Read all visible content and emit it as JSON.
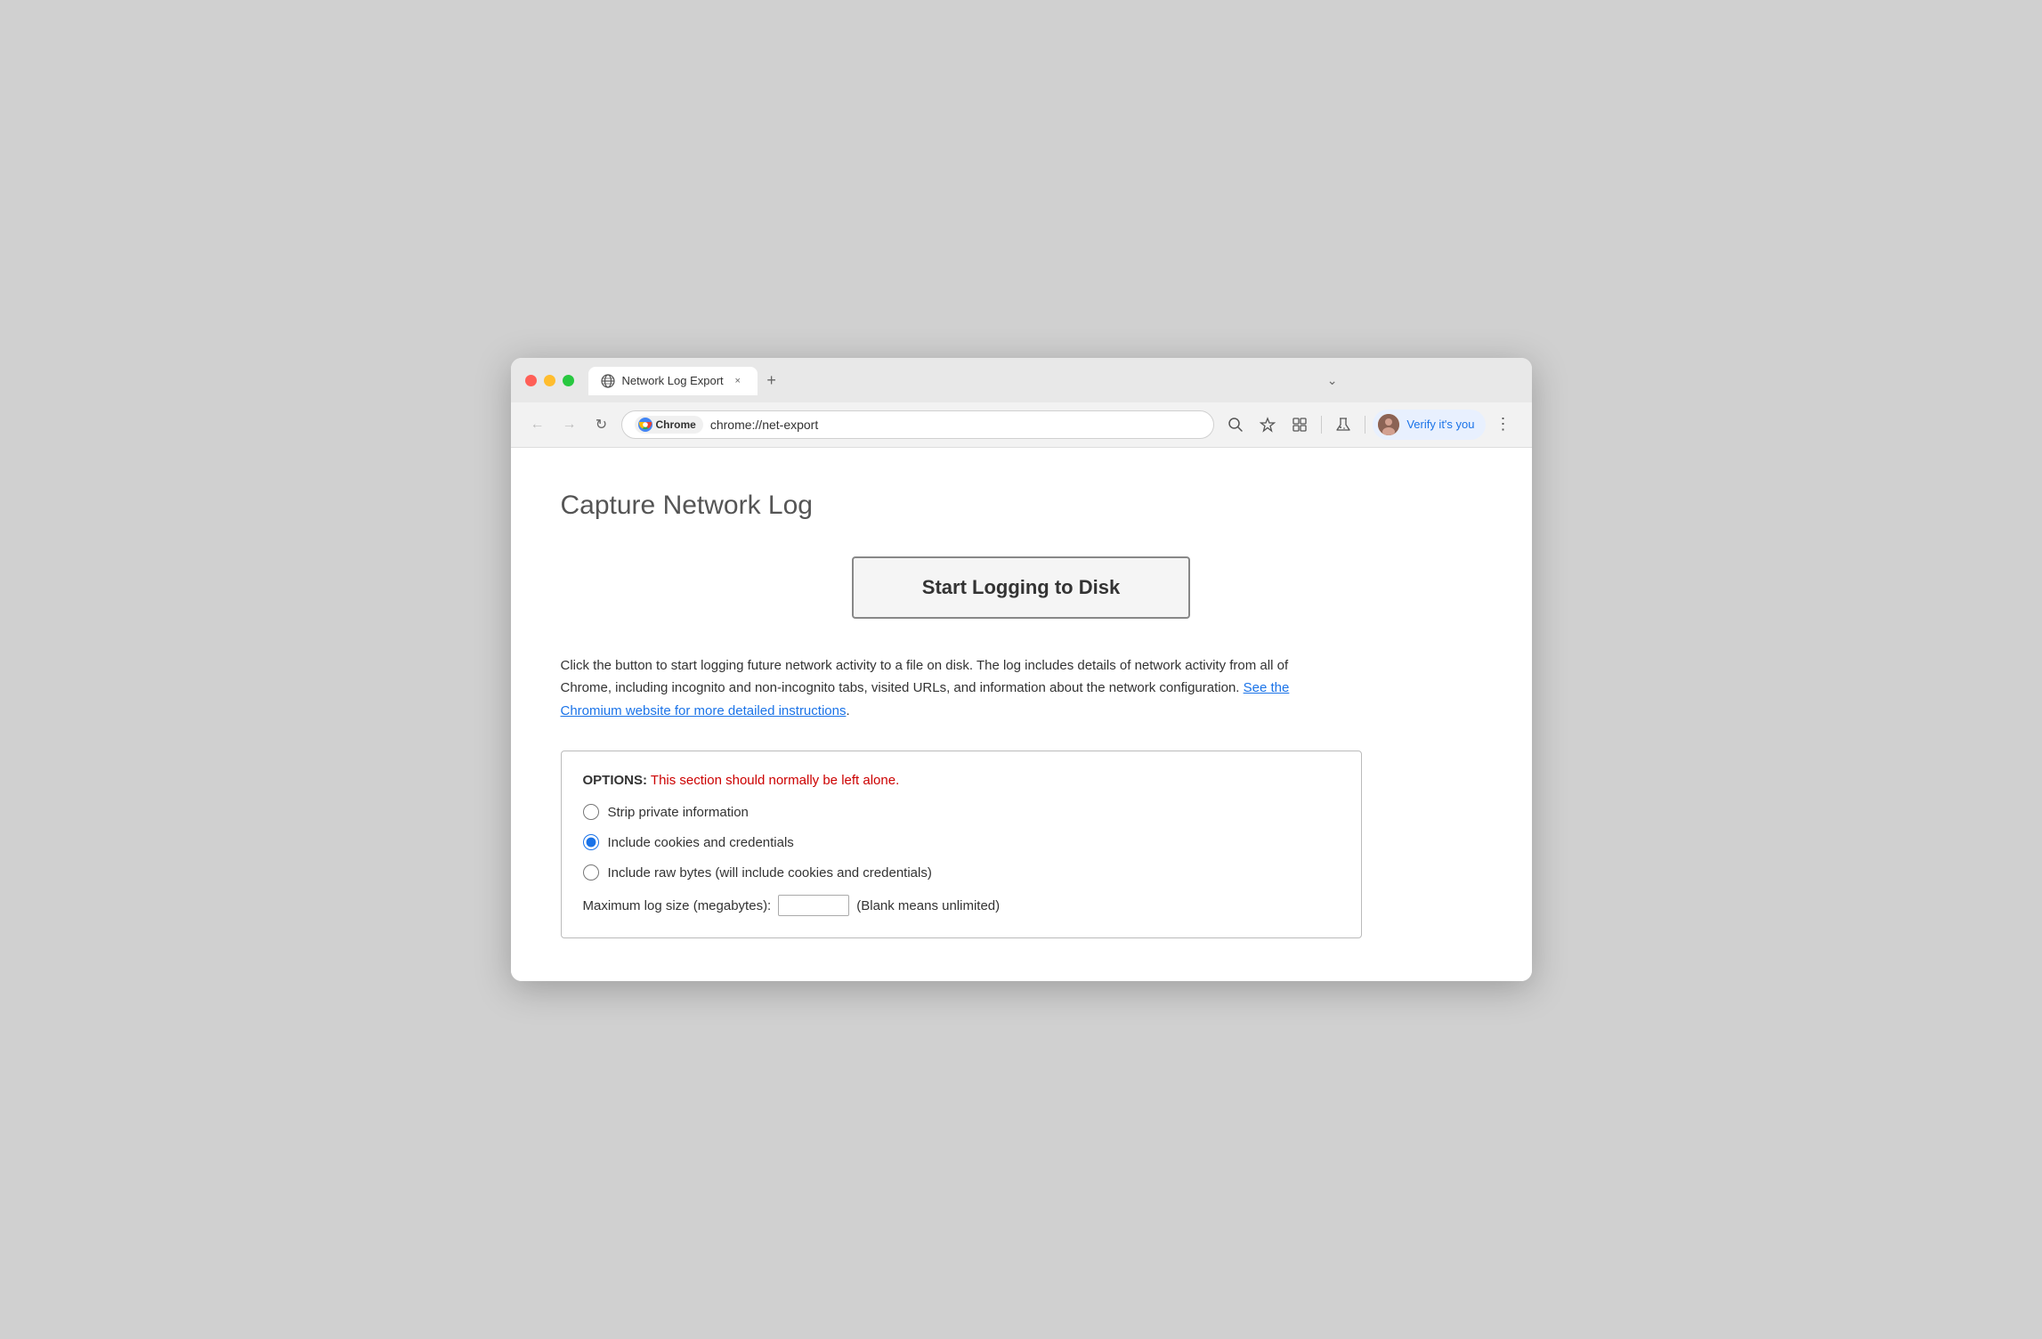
{
  "browser": {
    "tab_title": "Network Log Export",
    "tab_new_label": "+",
    "tab_expand_label": "⌄",
    "tab_close_label": "×"
  },
  "toolbar": {
    "back_label": "←",
    "forward_label": "→",
    "reload_label": "↻",
    "chrome_badge": "Chrome",
    "url": "chrome://net-export",
    "search_icon": "🔍",
    "star_icon": "☆",
    "extensions_icon": "🧩",
    "flask_icon": "⚗",
    "verify_label": "Verify it's you",
    "menu_label": "⋮"
  },
  "page": {
    "title": "Capture Network Log",
    "start_button": "Start Logging to Disk",
    "description_part1": "Click the button to start logging future network activity to a file on disk. The log includes details of network activity from all of Chrome, including incognito and non-incognito tabs, visited URLs, and information about the network configuration. ",
    "link_text": "See the Chromium website for more detailed instructions",
    "description_part2": ".",
    "options_label": "OPTIONS:",
    "options_warning": " This section should normally be left alone.",
    "option1": "Strip private information",
    "option2": "Include cookies and credentials",
    "option3": "Include raw bytes (will include cookies and credentials)",
    "max_log_label": "Maximum log size (megabytes):",
    "max_log_hint": "(Blank means unlimited)"
  }
}
